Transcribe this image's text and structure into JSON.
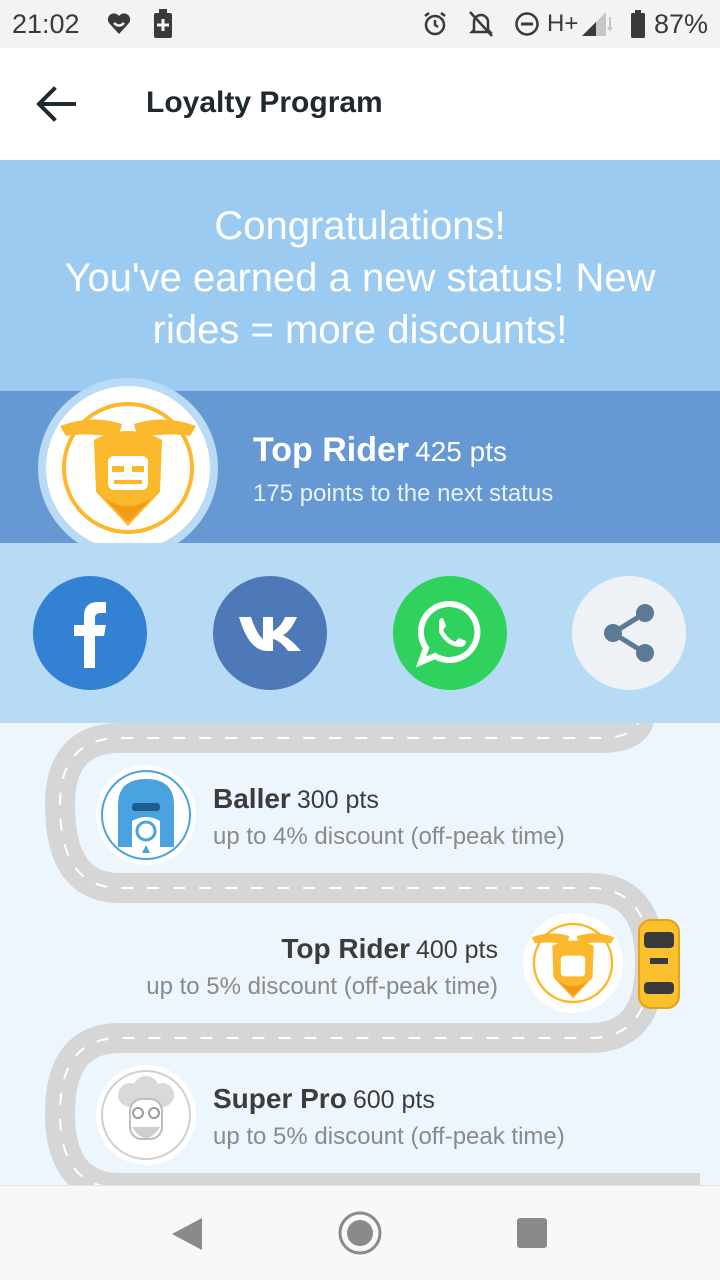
{
  "status_bar": {
    "time": "21:02",
    "network": "H+",
    "battery": "87%"
  },
  "app_bar": {
    "title": "Loyalty Program"
  },
  "congrats": {
    "line1": "Congratulations!",
    "line2": "You've earned a new status! New",
    "line3": "rides = more discounts!"
  },
  "current_status": {
    "name": "Top Rider",
    "points": "425 pts",
    "next": "175 points to the next status"
  },
  "share": {
    "buttons": [
      "facebook-icon",
      "vk-icon",
      "whatsapp-icon",
      "share-icon"
    ]
  },
  "levels": [
    {
      "name": "Baller",
      "points": "300 pts",
      "desc": "up to 4% discount (off-peak time)"
    },
    {
      "name": "Top Rider",
      "points": "400 pts",
      "desc": "up to 5% discount (off-peak time)"
    },
    {
      "name": "Super Pro",
      "points": "600 pts",
      "desc": "up to 5% discount (off-peak time)"
    }
  ],
  "colors": {
    "congrats_bg": "#9ccbf2",
    "status_bg": "#6699d4",
    "share_bg": "#b7daf5",
    "facebook": "#3281d3",
    "vk": "#4d79b9",
    "whatsapp": "#2fd25c",
    "accent_yellow": "#fbb82c"
  }
}
